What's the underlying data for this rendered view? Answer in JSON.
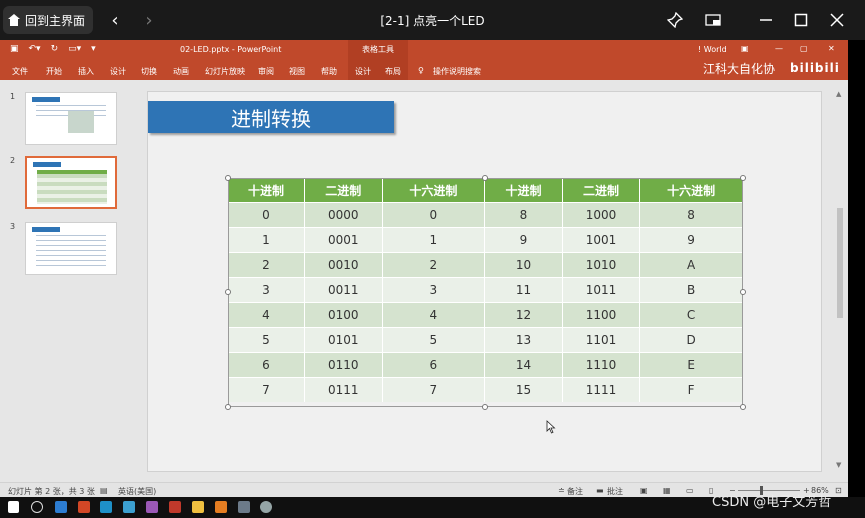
{
  "player": {
    "home_label": "回到主界面",
    "title": "[2-1] 点亮一个LED",
    "icons": [
      "home-icon",
      "chevron-left-icon",
      "chevron-right-icon",
      "pin-icon",
      "picture-in-picture-icon",
      "minimize-icon",
      "maximize-icon",
      "close-icon"
    ]
  },
  "ppt": {
    "doc_title": "02-LED.pptx  -  PowerPoint",
    "context_tab": "表格工具",
    "user": "World",
    "ribbon_tabs": [
      "文件",
      "开始",
      "插入",
      "设计",
      "切换",
      "动画",
      "幻灯片放映",
      "审阅",
      "视图",
      "帮助",
      "设计",
      "布局"
    ],
    "tell_me": "操作说明搜索",
    "watermark": "江科大自化协",
    "watermark_logo": "bilibili"
  },
  "thumbnails": [
    {
      "num": "1"
    },
    {
      "num": "2"
    },
    {
      "num": "3"
    }
  ],
  "slide": {
    "title": "进制转换",
    "table": {
      "headers": [
        "十进制",
        "二进制",
        "十六进制",
        "十进制",
        "二进制",
        "十六进制"
      ],
      "rows": [
        [
          "0",
          "0000",
          "0",
          "8",
          "1000",
          "8"
        ],
        [
          "1",
          "0001",
          "1",
          "9",
          "1001",
          "9"
        ],
        [
          "2",
          "0010",
          "2",
          "10",
          "1010",
          "A"
        ],
        [
          "3",
          "0011",
          "3",
          "11",
          "1011",
          "B"
        ],
        [
          "4",
          "0100",
          "4",
          "12",
          "1100",
          "C"
        ],
        [
          "5",
          "0101",
          "5",
          "13",
          "1101",
          "D"
        ],
        [
          "6",
          "0110",
          "6",
          "14",
          "1110",
          "E"
        ],
        [
          "7",
          "0111",
          "7",
          "15",
          "1111",
          "F"
        ]
      ]
    }
  },
  "statusbar": {
    "slide_info": "幻灯片 第 2 张，共 3 张",
    "language": "英语(美国)",
    "notes": "备注",
    "comments": "批注",
    "zoom": "86%"
  },
  "overlay": {
    "csdn": "CSDN @电子文芳哲"
  },
  "colors": {
    "ppt_accent": "#c0492b",
    "table_header": "#70ad47",
    "title_box": "#2e74b5"
  }
}
